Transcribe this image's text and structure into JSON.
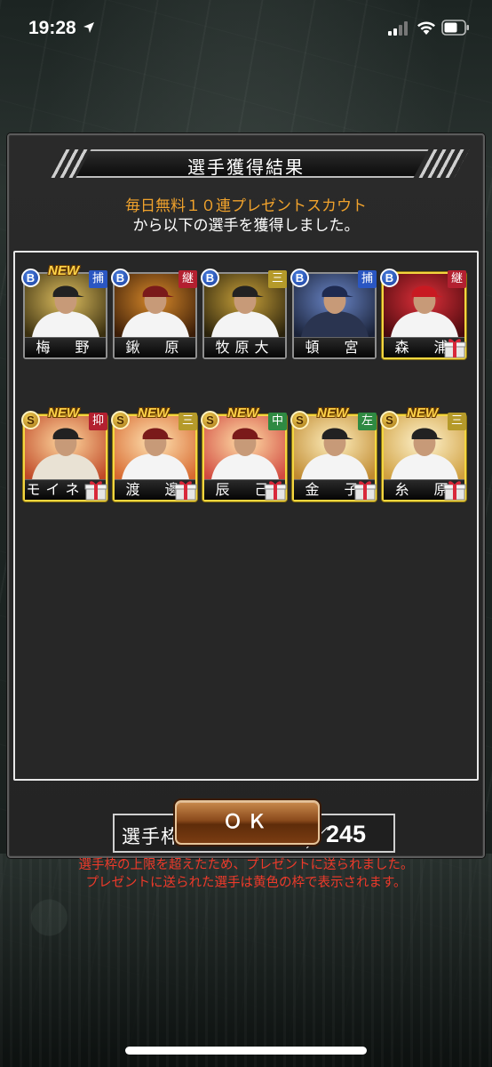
{
  "status_bar": {
    "time": "19:28",
    "icons": [
      "location-arrow-icon",
      "cellular-signal-icon",
      "wifi-icon",
      "battery-icon"
    ]
  },
  "dialog": {
    "title": "選手獲得結果",
    "scout_name": "毎日無料１０連プレゼントスカウト",
    "message": "から以下の選手を獲得しました。"
  },
  "players": [
    {
      "name": "梅　野",
      "rank": "B",
      "position": "捕",
      "new": "NEW",
      "gift": false
    },
    {
      "name": "鍬　原",
      "rank": "B",
      "position": "継",
      "new": "",
      "gift": false
    },
    {
      "name": "牧原大",
      "rank": "B",
      "position": "三",
      "new": "",
      "gift": false
    },
    {
      "name": "頓　宮",
      "rank": "B",
      "position": "捕",
      "new": "",
      "gift": false
    },
    {
      "name": "森　浦",
      "rank": "B",
      "position": "継",
      "new": "",
      "gift": true
    },
    {
      "name": "モイネロ",
      "rank": "S",
      "position": "抑",
      "new": "NEW",
      "gift": true
    },
    {
      "name": "渡　邊",
      "rank": "S",
      "position": "三",
      "new": "NEW",
      "gift": true
    },
    {
      "name": "辰　己",
      "rank": "S",
      "position": "中",
      "new": "NEW",
      "gift": true
    },
    {
      "name": "金　子",
      "rank": "S",
      "position": "左",
      "new": "NEW",
      "gift": true
    },
    {
      "name": "糸　原",
      "rank": "S",
      "position": "三",
      "new": "NEW",
      "gift": true
    }
  ],
  "slots": {
    "label": "選手枠：",
    "current": "245",
    "separator": "／",
    "max": "245"
  },
  "warnings": [
    "選手枠の上限を超えたため、プレゼントに送られました。",
    "プレゼントに送られた選手は黄色の枠で表示されます。"
  ],
  "ok_button": "ＯＫ",
  "colors": {
    "accent_orange": "#f0a22c",
    "warning_red": "#ee3a2a",
    "gift_frame_gold": "#f4d640",
    "count_red": "#e23b2b"
  }
}
